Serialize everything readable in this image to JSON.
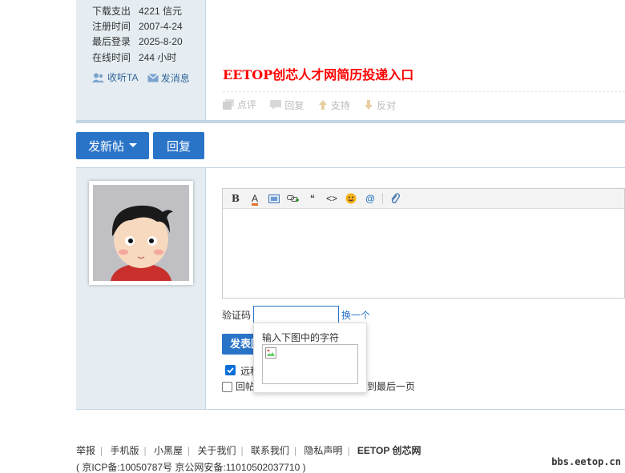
{
  "user_stats": [
    {
      "label": "下载支出",
      "value": "4221 信元"
    },
    {
      "label": "注册时间",
      "value": "2007-4-24"
    },
    {
      "label": "最后登录",
      "value": "2025-8-20"
    },
    {
      "label": "在线时间",
      "value": "244 小时"
    }
  ],
  "user_actions": {
    "follow": "收听TA",
    "message": "发消息"
  },
  "post": {
    "ad_link": "EETOP创芯人才网简历投递入口",
    "ops": {
      "comment": "点评",
      "reply": "回复",
      "support": "支持",
      "oppose": "反对"
    }
  },
  "buttons": {
    "new_post": "发新帖",
    "reply": "回复"
  },
  "editor": {
    "toolbar": [
      "bold-icon",
      "font-color-icon",
      "image-icon",
      "link-icon",
      "quote-icon",
      "code-icon",
      "smiley-icon",
      "mention-icon",
      "attachment-icon"
    ],
    "bold_glyph": "B",
    "font_glyph": "A",
    "quote_glyph": "“",
    "code_glyph": "<>",
    "at_glyph": "@"
  },
  "captcha": {
    "label": "验证码",
    "change": "换一个",
    "popup_text": "输入下图中的字符"
  },
  "submit": {
    "label": "发表回复"
  },
  "options": {
    "remote": {
      "label": "远程",
      "checked": true
    },
    "goto_last": {
      "prefix": "回帖",
      "suffix": "到最后一页",
      "checked": false
    }
  },
  "footer": {
    "links": [
      "举报",
      "手机版",
      "小黑屋",
      "关于我们",
      "联系我们",
      "隐私声明"
    ],
    "brand": "EETOP 创芯网",
    "icp": "( 京ICP备:10050787号 京公网安备:11010502037710 )",
    "watermark": "bbs.eetop.cn"
  },
  "colors": {
    "accent": "#2a74c8",
    "sidebar": "#e5edf2",
    "ad": "#ff0000"
  }
}
